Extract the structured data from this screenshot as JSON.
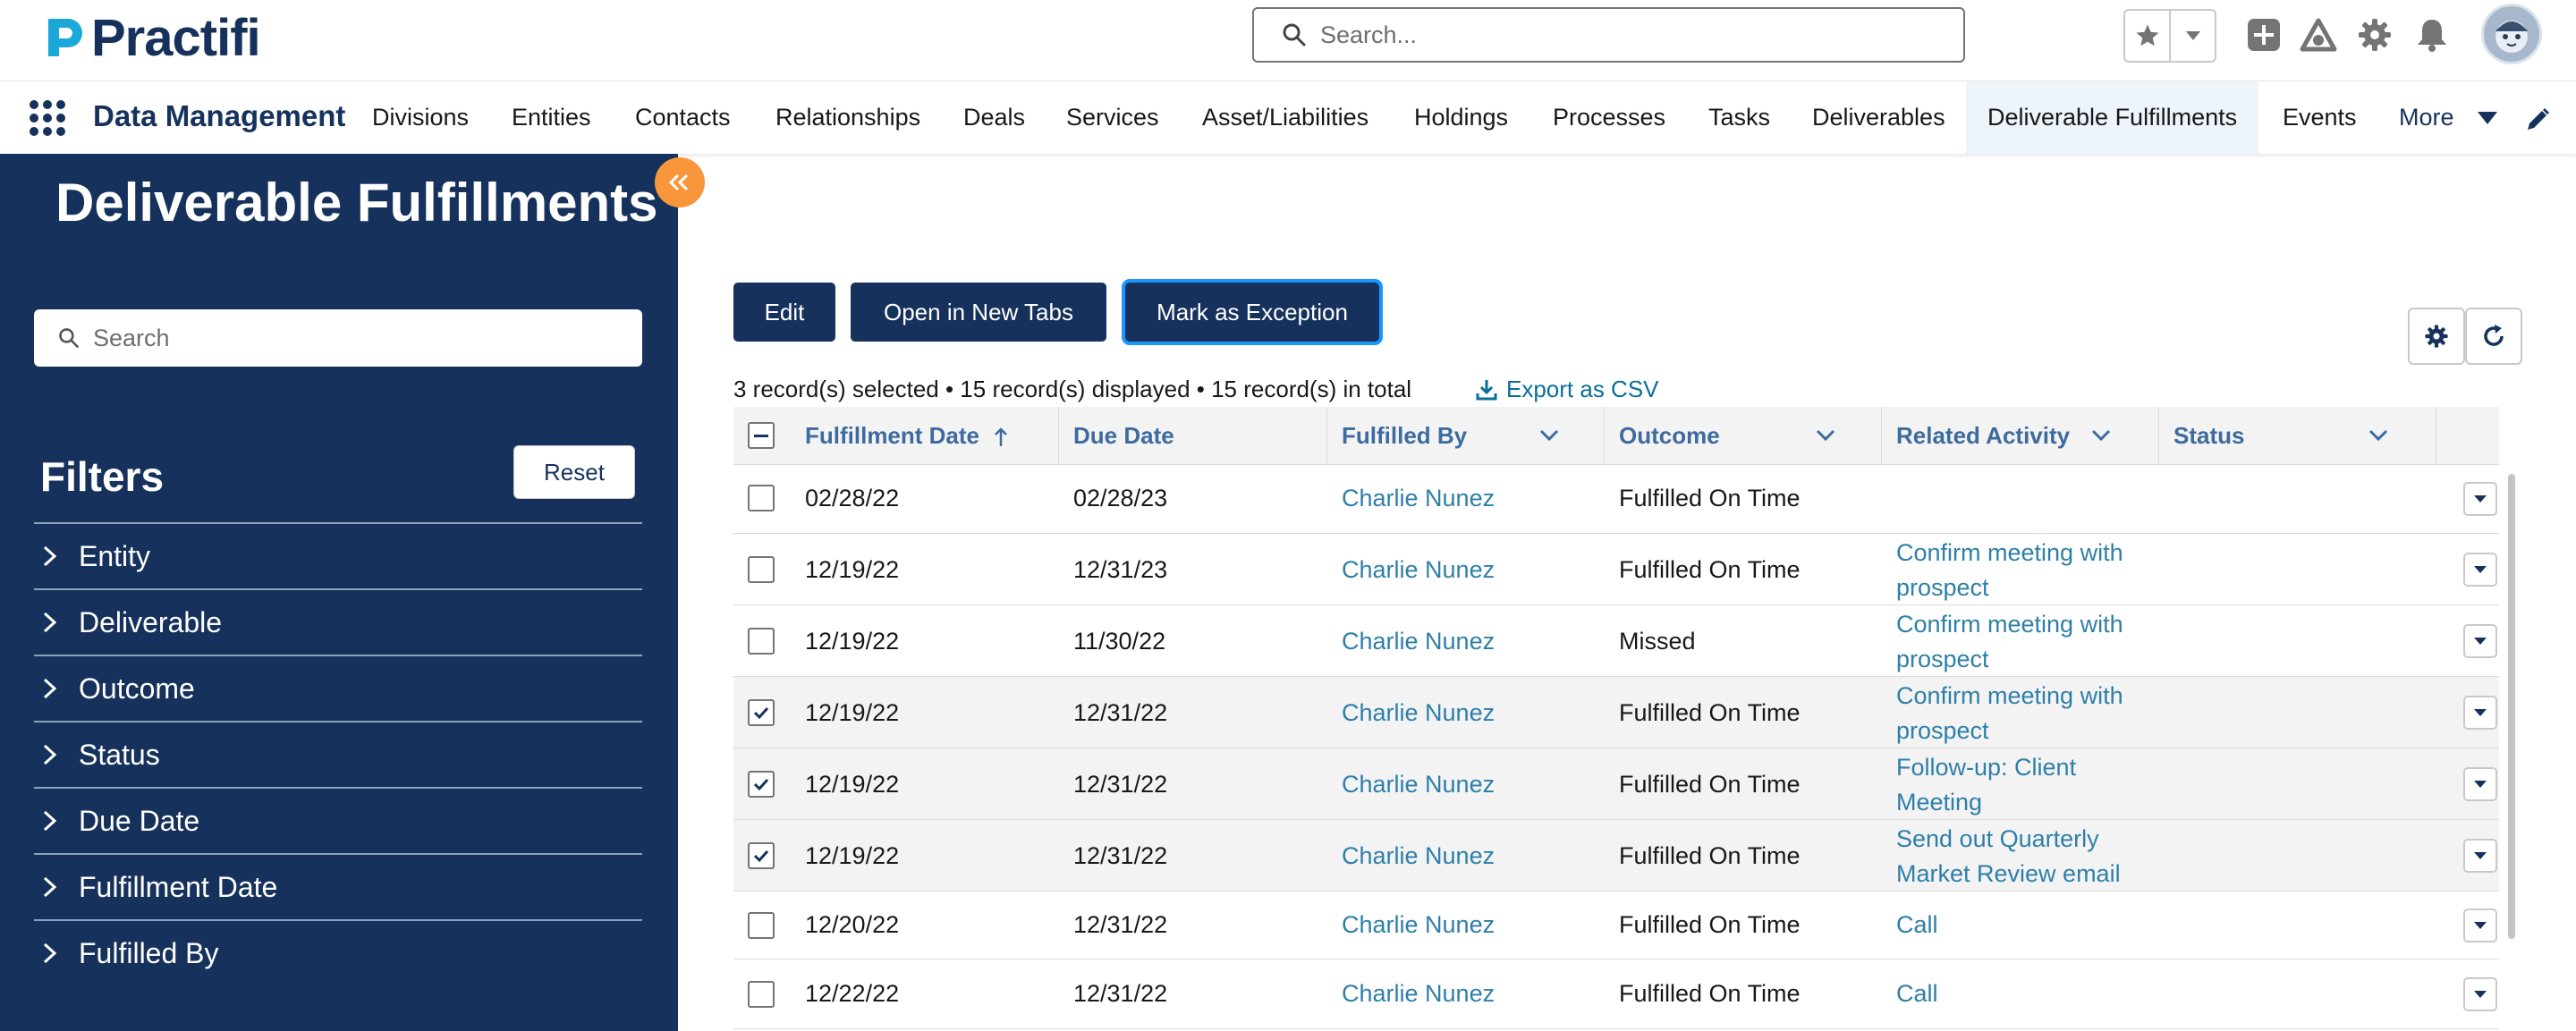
{
  "brand": {
    "name": "Practifi",
    "color": "#16325c",
    "accent": "#19a8d8"
  },
  "search": {
    "placeholder": "Search..."
  },
  "header_icons": [
    "star-icon",
    "chevron-down-icon",
    "add-icon",
    "trailhead-icon",
    "gear-icon",
    "bell-icon",
    "avatar"
  ],
  "nav": {
    "app_name": "Data Management",
    "items": [
      "Divisions",
      "Entities",
      "Contacts",
      "Relationships",
      "Deals",
      "Services",
      "Asset/Liabilities",
      "Holdings",
      "Processes",
      "Tasks",
      "Deliverables",
      "Deliverable Fulfillments",
      "Events"
    ],
    "active": "Deliverable Fulfillments",
    "more": "More"
  },
  "sidebar": {
    "title": "Deliverable Fulfillments",
    "search_placeholder": "Search",
    "filters_title": "Filters",
    "reset": "Reset",
    "filters": [
      "Entity",
      "Deliverable",
      "Outcome",
      "Status",
      "Due Date",
      "Fulfillment Date",
      "Fulfilled By"
    ]
  },
  "actions": {
    "edit": "Edit",
    "open_tabs": "Open in New Tabs",
    "mark_exception": "Mark as Exception"
  },
  "summary": "3 record(s) selected • 15 record(s) displayed • 15 record(s) in total",
  "export": "Export as CSV",
  "table": {
    "columns": [
      "Fulfillment Date",
      "Due Date",
      "Fulfilled By",
      "Outcome",
      "Related Activity",
      "Status"
    ],
    "rows": [
      {
        "selected": false,
        "fulfillment_date": "02/28/22",
        "due_date": "02/28/23",
        "fulfilled_by": "Charlie Nunez",
        "outcome": "Fulfilled On Time",
        "related_1": "",
        "related_2": "",
        "status": ""
      },
      {
        "selected": false,
        "fulfillment_date": "12/19/22",
        "due_date": "12/31/23",
        "fulfilled_by": "Charlie Nunez",
        "outcome": "Fulfilled On Time",
        "related_1": "Confirm meeting with",
        "related_2": "prospect",
        "status": ""
      },
      {
        "selected": false,
        "fulfillment_date": "12/19/22",
        "due_date": "11/30/22",
        "fulfilled_by": "Charlie Nunez",
        "outcome": "Missed",
        "related_1": "Confirm meeting with",
        "related_2": "prospect",
        "status": ""
      },
      {
        "selected": true,
        "fulfillment_date": "12/19/22",
        "due_date": "12/31/22",
        "fulfilled_by": "Charlie Nunez",
        "outcome": "Fulfilled On Time",
        "related_1": "Confirm meeting with",
        "related_2": "prospect",
        "status": ""
      },
      {
        "selected": true,
        "fulfillment_date": "12/19/22",
        "due_date": "12/31/22",
        "fulfilled_by": "Charlie Nunez",
        "outcome": "Fulfilled On Time",
        "related_1": "Follow-up: Client",
        "related_2": "Meeting",
        "status": ""
      },
      {
        "selected": true,
        "fulfillment_date": "12/19/22",
        "due_date": "12/31/22",
        "fulfilled_by": "Charlie Nunez",
        "outcome": "Fulfilled On Time",
        "related_1": "Send out Quarterly",
        "related_2": "Market Review email",
        "status": ""
      },
      {
        "selected": false,
        "fulfillment_date": "12/20/22",
        "due_date": "12/31/22",
        "fulfilled_by": "Charlie Nunez",
        "outcome": "Fulfilled On Time",
        "related_1": "Call",
        "related_2": "",
        "status": ""
      },
      {
        "selected": false,
        "fulfillment_date": "12/22/22",
        "due_date": "12/31/22",
        "fulfilled_by": "Charlie Nunez",
        "outcome": "Fulfilled On Time",
        "related_1": "Call",
        "related_2": "",
        "status": ""
      }
    ]
  }
}
